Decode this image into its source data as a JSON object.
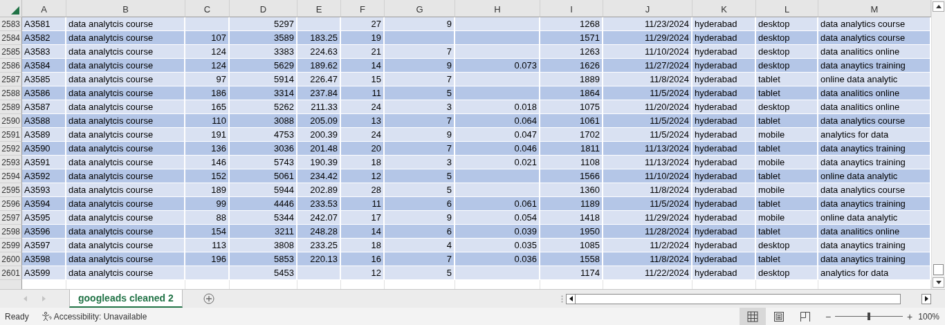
{
  "sheet": {
    "columns": [
      "A",
      "B",
      "C",
      "D",
      "E",
      "F",
      "G",
      "H",
      "I",
      "J",
      "K",
      "L",
      "M"
    ],
    "rows": [
      {
        "number": "2583",
        "cells": [
          "A3581",
          "data analytcis course",
          null,
          "5297",
          null,
          "27",
          "9",
          null,
          "1268",
          "11/23/2024",
          "hyderabad",
          "desktop",
          "data analytics course"
        ]
      },
      {
        "number": "2584",
        "cells": [
          "A3582",
          "data analytcis course",
          "107",
          "3589",
          "183.25",
          "19",
          null,
          null,
          "1571",
          "11/29/2024",
          "hyderabad",
          "desktop",
          "data analytics course"
        ]
      },
      {
        "number": "2585",
        "cells": [
          "A3583",
          "data analytcis course",
          "124",
          "3383",
          "224.63",
          "21",
          "7",
          null,
          "1263",
          "11/10/2024",
          "hyderabad",
          "desktop",
          "data analitics online"
        ]
      },
      {
        "number": "2586",
        "cells": [
          "A3584",
          "data analytcis course",
          "124",
          "5629",
          "189.62",
          "14",
          "9",
          "0.073",
          "1626",
          "11/27/2024",
          "hyderabad",
          "desktop",
          "data anaytics training"
        ]
      },
      {
        "number": "2587",
        "cells": [
          "A3585",
          "data analytcis course",
          "97",
          "5914",
          "226.47",
          "15",
          "7",
          null,
          "1889",
          "11/8/2024",
          "hyderabad",
          "tablet",
          "online data analytic"
        ]
      },
      {
        "number": "2588",
        "cells": [
          "A3586",
          "data analytcis course",
          "186",
          "3314",
          "237.84",
          "11",
          "5",
          null,
          "1864",
          "11/5/2024",
          "hyderabad",
          "tablet",
          "data analitics online"
        ]
      },
      {
        "number": "2589",
        "cells": [
          "A3587",
          "data analytcis course",
          "165",
          "5262",
          "211.33",
          "24",
          "3",
          "0.018",
          "1075",
          "11/20/2024",
          "hyderabad",
          "desktop",
          "data analitics online"
        ]
      },
      {
        "number": "2590",
        "cells": [
          "A3588",
          "data analytcis course",
          "110",
          "3088",
          "205.09",
          "13",
          "7",
          "0.064",
          "1061",
          "11/5/2024",
          "hyderabad",
          "tablet",
          "data analytics course"
        ]
      },
      {
        "number": "2591",
        "cells": [
          "A3589",
          "data analytcis course",
          "191",
          "4753",
          "200.39",
          "24",
          "9",
          "0.047",
          "1702",
          "11/5/2024",
          "hyderabad",
          "mobile",
          "analytics for data"
        ]
      },
      {
        "number": "2592",
        "cells": [
          "A3590",
          "data analytcis course",
          "136",
          "3036",
          "201.48",
          "20",
          "7",
          "0.046",
          "1811",
          "11/13/2024",
          "hyderabad",
          "tablet",
          "data anaytics training"
        ]
      },
      {
        "number": "2593",
        "cells": [
          "A3591",
          "data analytcis course",
          "146",
          "5743",
          "190.39",
          "18",
          "3",
          "0.021",
          "1108",
          "11/13/2024",
          "hyderabad",
          "mobile",
          "data anaytics training"
        ]
      },
      {
        "number": "2594",
        "cells": [
          "A3592",
          "data analytcis course",
          "152",
          "5061",
          "234.42",
          "12",
          "5",
          null,
          "1566",
          "11/10/2024",
          "hyderabad",
          "tablet",
          "online data analytic"
        ]
      },
      {
        "number": "2595",
        "cells": [
          "A3593",
          "data analytcis course",
          "189",
          "5944",
          "202.89",
          "28",
          "5",
          null,
          "1360",
          "11/8/2024",
          "hyderabad",
          "mobile",
          "data analytics course"
        ]
      },
      {
        "number": "2596",
        "cells": [
          "A3594",
          "data analytcis course",
          "99",
          "4446",
          "233.53",
          "11",
          "6",
          "0.061",
          "1189",
          "11/5/2024",
          "hyderabad",
          "tablet",
          "data anaytics training"
        ]
      },
      {
        "number": "2597",
        "cells": [
          "A3595",
          "data analytcis course",
          "88",
          "5344",
          "242.07",
          "17",
          "9",
          "0.054",
          "1418",
          "11/29/2024",
          "hyderabad",
          "mobile",
          "online data analytic"
        ]
      },
      {
        "number": "2598",
        "cells": [
          "A3596",
          "data analytcis course",
          "154",
          "3211",
          "248.28",
          "14",
          "6",
          "0.039",
          "1950",
          "11/28/2024",
          "hyderabad",
          "tablet",
          "data analitics online"
        ]
      },
      {
        "number": "2599",
        "cells": [
          "A3597",
          "data analytcis course",
          "113",
          "3808",
          "233.25",
          "18",
          "4",
          "0.035",
          "1085",
          "11/2/2024",
          "hyderabad",
          "desktop",
          "data anaytics training"
        ]
      },
      {
        "number": "2600",
        "cells": [
          "A3598",
          "data analytcis course",
          "196",
          "5853",
          "220.13",
          "16",
          "7",
          "0.036",
          "1558",
          "11/8/2024",
          "hyderabad",
          "tablet",
          "data anaytics training"
        ]
      },
      {
        "number": "2601",
        "cells": [
          "A3599",
          "data analytcis course",
          null,
          "5453",
          null,
          "12",
          "5",
          null,
          "1174",
          "11/22/2024",
          "hyderabad",
          "desktop",
          "analytics for data"
        ]
      }
    ]
  },
  "sheet_tabs": [
    {
      "label": "googleads cleaned 2",
      "selected": true
    }
  ],
  "status_bar": {
    "status": "Ready",
    "accessibility": "Accessibility: Unavailable",
    "views": [
      {
        "kind": "normal",
        "selected": true
      },
      {
        "kind": "page_layout",
        "selected": false
      },
      {
        "kind": "page_break",
        "selected": false
      }
    ],
    "zoom_out": "−",
    "zoom_in": "+",
    "zoom": {
      "level": 0.5
    },
    "zoom_reading": "100%"
  }
}
